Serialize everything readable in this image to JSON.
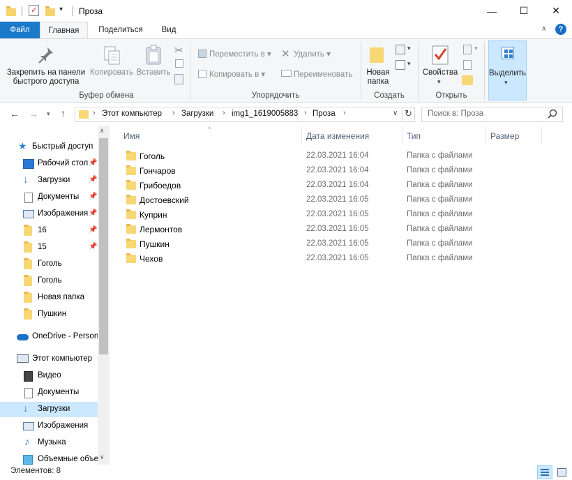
{
  "window": {
    "title": "Проза",
    "controls": {
      "minimize": "—",
      "maximize": "☐",
      "close": "✕"
    }
  },
  "ribbon_tabs": {
    "file": "Файл",
    "home": "Главная",
    "share": "Поделиться",
    "view": "Вид"
  },
  "ribbon": {
    "clipboard": {
      "pin_line1": "Закрепить на панели",
      "pin_line2": "быстрого доступа",
      "copy": "Копировать",
      "paste": "Вставить",
      "group": "Буфер обмена"
    },
    "organize": {
      "move_to": "Переместить в",
      "copy_to": "Копировать в",
      "delete": "Удалить",
      "rename": "Переименовать",
      "group": "Упорядочить"
    },
    "new": {
      "new_folder_line1": "Новая",
      "new_folder_line2": "папка",
      "group": "Создать"
    },
    "open": {
      "properties": "Свойства",
      "group": "Открыть"
    },
    "select": {
      "label": "Выделить"
    }
  },
  "address": {
    "crumbs": [
      "Этот компьютер",
      "Загрузки",
      "img1_1619005883",
      "Проза"
    ],
    "search_placeholder": "Поиск в: Проза"
  },
  "nav": {
    "quick_access": "Быстрый доступ",
    "pinned": [
      "Рабочий стол",
      "Загрузки",
      "Документы",
      "Изображения",
      "16",
      "15"
    ],
    "recent": [
      "Гоголь",
      "Гоголь",
      "Новая папка",
      "Пушкин"
    ],
    "onedrive": "OneDrive - Personal",
    "this_pc": "Этот компьютер",
    "pc_items": [
      "Видео",
      "Документы",
      "Загрузки",
      "Изображения",
      "Музыка",
      "Объемные объекты"
    ]
  },
  "columns": {
    "name": "Имя",
    "date": "Дата изменения",
    "type": "Тип",
    "size": "Размер"
  },
  "files": [
    {
      "name": "Гоголь",
      "date": "22.03.2021 16:04",
      "type": "Папка с файлами"
    },
    {
      "name": "Гончаров",
      "date": "22.03.2021 16:04",
      "type": "Папка с файлами"
    },
    {
      "name": "Грибоедов",
      "date": "22.03.2021 16:04",
      "type": "Папка с файлами"
    },
    {
      "name": "Достоевский",
      "date": "22.03.2021 16:05",
      "type": "Папка с файлами"
    },
    {
      "name": "Куприн",
      "date": "22.03.2021 16:05",
      "type": "Папка с файлами"
    },
    {
      "name": "Лермонтов",
      "date": "22.03.2021 16:05",
      "type": "Папка с файлами"
    },
    {
      "name": "Пушкин",
      "date": "22.03.2021 16:05",
      "type": "Папка с файлами"
    },
    {
      "name": "Чехов",
      "date": "22.03.2021 16:05",
      "type": "Папка с файлами"
    }
  ],
  "status": {
    "count": "Элементов: 8"
  },
  "colors": {
    "accent": "#1979ca",
    "selection": "#cce8ff",
    "folder": "#f8d775"
  }
}
